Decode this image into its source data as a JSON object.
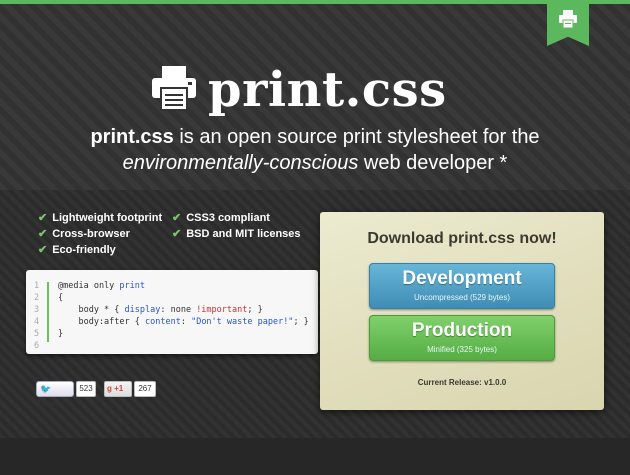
{
  "header": {
    "logo_text": "print.css",
    "tagline_bold": "print.css",
    "tagline_rest": " is an open source print stylesheet for the",
    "tagline_italic": "environmentally-conscious",
    "tagline_end": " web developer *"
  },
  "features": [
    {
      "label": "Lightweight footprint"
    },
    {
      "label": "Cross-browser"
    },
    {
      "label": "Eco-friendly"
    },
    {
      "label": "CSS3 compliant"
    },
    {
      "label": "BSD and MIT licenses"
    }
  ],
  "code": {
    "line_numbers": [
      "1",
      "2",
      "3",
      "4",
      "5",
      "6"
    ]
  },
  "social": {
    "tweet_label": "Tweet",
    "tweet_count": "523",
    "gplus_label": "+1",
    "gplus_count": "267"
  },
  "download": {
    "title": "Download print.css now!",
    "dev_label": "Development",
    "dev_sub": "Uncompressed (529 bytes)",
    "prod_label": "Production",
    "prod_sub": "Minified (325 bytes)",
    "release": "Current Release: v1.0.0"
  },
  "colors": {
    "accent_green": "#5cb85c",
    "dev_blue": "#4f9fc6",
    "prod_green": "#66bd52",
    "panel_bg": "#e2dfbe"
  },
  "icons": [
    "printer-icon",
    "check-icon",
    "twitter-icon",
    "google-plus-icon"
  ]
}
